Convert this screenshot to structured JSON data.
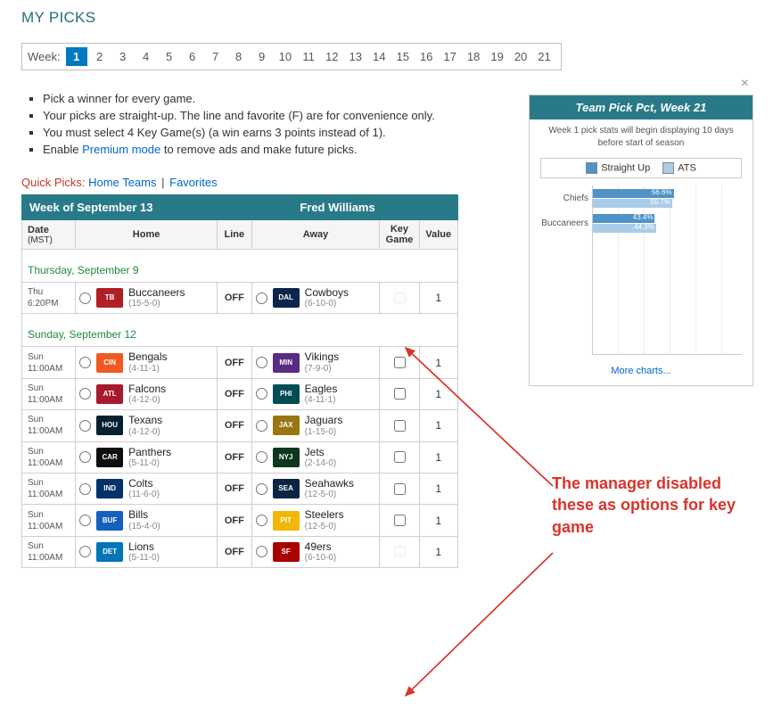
{
  "title": "MY PICKS",
  "week_label": "Week:",
  "weeks": [
    "1",
    "2",
    "3",
    "4",
    "5",
    "6",
    "7",
    "8",
    "9",
    "10",
    "11",
    "12",
    "13",
    "14",
    "15",
    "16",
    "17",
    "18",
    "19",
    "20",
    "21"
  ],
  "active_week": 0,
  "rules": [
    {
      "text": "Pick a winner for every game."
    },
    {
      "text": "Your picks are straight-up. The line and favorite (F) are for convenience only."
    },
    {
      "text": "You must select 4 Key Game(s) (a win earns 3 points instead of 1)."
    },
    {
      "prefix": "Enable ",
      "link": "Premium mode",
      "suffix": " to remove ads and make future picks."
    }
  ],
  "quick": {
    "label": "Quick Picks:",
    "home": "Home Teams",
    "fav": "Favorites"
  },
  "header": {
    "left": "Week of September 13",
    "right": "Fred Williams"
  },
  "cols": {
    "date": "Date",
    "date_sub": "(MST)",
    "home": "Home",
    "line": "Line",
    "away": "Away",
    "key": "Key Game",
    "value": "Value"
  },
  "days": [
    {
      "label": "Thursday, September 9",
      "games": [
        {
          "dt": "Thu",
          "tm": "6:20PM",
          "home": {
            "name": "Buccaneers",
            "rec": "(15-5-0)",
            "c": "#b01f24",
            "txt": "TB"
          },
          "line": "OFF",
          "away": {
            "name": "Cowboys",
            "rec": "(6-10-0)",
            "c": "#0d254c",
            "txt": "DAL"
          },
          "key_disabled": true,
          "value": "1"
        }
      ]
    },
    {
      "label": "Sunday, September 12",
      "games": [
        {
          "dt": "Sun",
          "tm": "11:00AM",
          "home": {
            "name": "Bengals",
            "rec": "(4-11-1)",
            "c": "#f05a22",
            "txt": "CIN"
          },
          "line": "OFF",
          "away": {
            "name": "Vikings",
            "rec": "(7-9-0)",
            "c": "#582c83",
            "txt": "MIN"
          },
          "key_disabled": false,
          "value": "1"
        },
        {
          "dt": "Sun",
          "tm": "11:00AM",
          "home": {
            "name": "Falcons",
            "rec": "(4-12-0)",
            "c": "#a6192e",
            "txt": "ATL"
          },
          "line": "OFF",
          "away": {
            "name": "Eagles",
            "rec": "(4-11-1)",
            "c": "#004c54",
            "txt": "PHI"
          },
          "key_disabled": false,
          "value": "1"
        },
        {
          "dt": "Sun",
          "tm": "11:00AM",
          "home": {
            "name": "Texans",
            "rec": "(4-12-0)",
            "c": "#03202f",
            "txt": "HOU"
          },
          "line": "OFF",
          "away": {
            "name": "Jaguars",
            "rec": "(1-15-0)",
            "c": "#9a7611",
            "txt": "JAX"
          },
          "key_disabled": false,
          "value": "1"
        },
        {
          "dt": "Sun",
          "tm": "11:00AM",
          "home": {
            "name": "Panthers",
            "rec": "(5-11-0)",
            "c": "#0d0d0d",
            "txt": "CAR"
          },
          "line": "OFF",
          "away": {
            "name": "Jets",
            "rec": "(2-14-0)",
            "c": "#0c371d",
            "txt": "NYJ"
          },
          "key_disabled": false,
          "value": "1"
        },
        {
          "dt": "Sun",
          "tm": "11:00AM",
          "home": {
            "name": "Colts",
            "rec": "(11-6-0)",
            "c": "#013369",
            "txt": "IND"
          },
          "line": "OFF",
          "away": {
            "name": "Seahawks",
            "rec": "(12-5-0)",
            "c": "#0b2444",
            "txt": "SEA"
          },
          "key_disabled": false,
          "value": "1"
        },
        {
          "dt": "Sun",
          "tm": "11:00AM",
          "home": {
            "name": "Bills",
            "rec": "(15-4-0)",
            "c": "#1560bd",
            "txt": "BUF"
          },
          "line": "OFF",
          "away": {
            "name": "Steelers",
            "rec": "(12-5-0)",
            "c": "#f2b705",
            "txt": "PIT"
          },
          "key_disabled": false,
          "value": "1"
        },
        {
          "dt": "Sun",
          "tm": "11:00AM",
          "home": {
            "name": "Lions",
            "rec": "(5-11-0)",
            "c": "#0076b6",
            "txt": "DET"
          },
          "line": "OFF",
          "away": {
            "name": "49ers",
            "rec": "(6-10-0)",
            "c": "#aa0000",
            "txt": "SF"
          },
          "key_disabled": true,
          "value": "1"
        }
      ]
    }
  ],
  "chart": {
    "title": "Team Pick Pct, Week 21",
    "note": "Week 1 pick stats will begin displaying 10 days before start of season",
    "legend": {
      "su": "Straight Up",
      "ats": "ATS"
    },
    "more": "More charts..."
  },
  "chart_data": {
    "type": "bar",
    "orientation": "horizontal",
    "categories": [
      "Chiefs",
      "Buccaneers"
    ],
    "series": [
      {
        "name": "Straight Up",
        "values": [
          56.6,
          43.4
        ]
      },
      {
        "name": "ATS",
        "values": [
          55.7,
          44.3
        ]
      }
    ],
    "xlim": [
      0,
      100
    ],
    "title": "Team Pick Pct, Week 21",
    "xlabel": "",
    "ylabel": ""
  },
  "annotation": "The manager disabled these as options for key game"
}
